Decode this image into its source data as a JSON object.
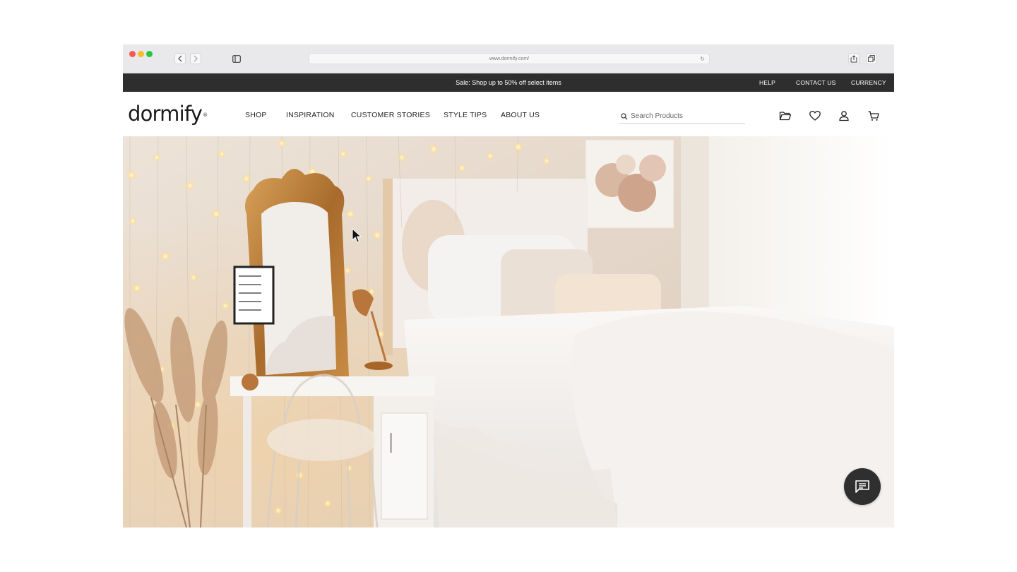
{
  "browser": {
    "url": "www.dormify.com/",
    "back_icon": "chevron-left-icon",
    "forward_icon": "chevron-right-icon",
    "sidebar_icon": "sidebar-icon",
    "share_icon": "share-icon",
    "tabs_icon": "tabs-icon",
    "reload_icon": "reload-icon"
  },
  "promo": {
    "message": "Sale: Shop up to 50% off select items",
    "links": [
      "HELP",
      "CONTACT US",
      "CURRENCY"
    ]
  },
  "header": {
    "logo": "dormify",
    "logo_mark": "®",
    "nav": [
      "SHOP",
      "INSPIRATION",
      "CUSTOMER STORIES",
      "STYLE TIPS",
      "ABOUT US"
    ],
    "search_placeholder": "Search Products",
    "icons": [
      "folder-icon",
      "heart-icon",
      "account-icon",
      "cart-icon"
    ]
  },
  "hero": {
    "image": "dorm room with ornate gold mirror, vanity desk, acrylic chair, pampas grass, fairy lights and white ruffled bed"
  },
  "chat": {
    "icon": "chat-icon"
  },
  "colors": {
    "promo_bg": "#2e2e2e",
    "chrome_bg": "#e9e8ea",
    "chat_bg": "#2f2f2f",
    "text": "#222222"
  }
}
